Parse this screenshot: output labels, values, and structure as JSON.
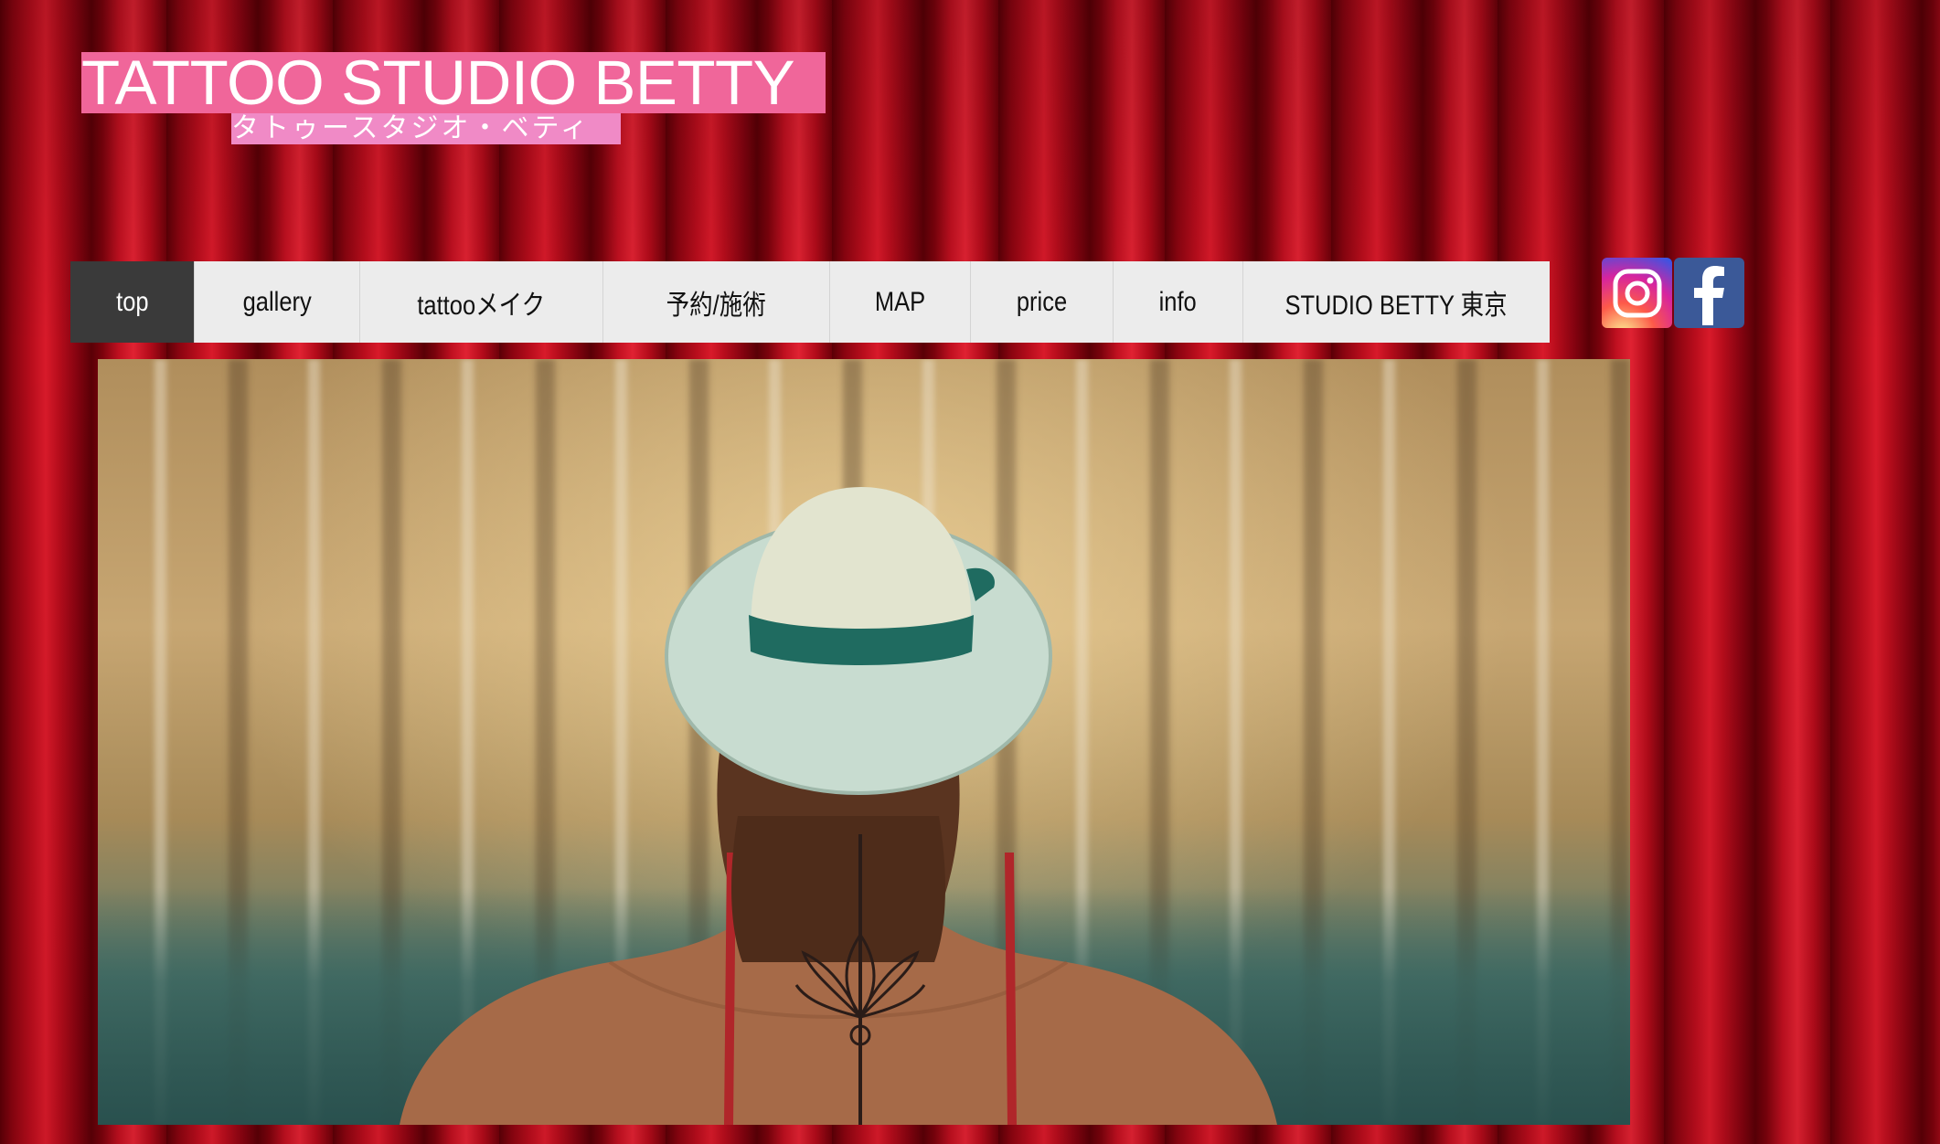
{
  "site": {
    "title": "TATTOO STUDIO BETTY",
    "subtitle": "タトゥースタジオ・ベティ"
  },
  "nav": {
    "items": [
      {
        "label": "top",
        "active": true
      },
      {
        "label": "gallery",
        "active": false
      },
      {
        "label": "tattooメイク",
        "active": false
      },
      {
        "label": "予約/施術",
        "active": false
      },
      {
        "label": "MAP",
        "active": false
      },
      {
        "label": "price",
        "active": false
      },
      {
        "label": "info",
        "active": false
      },
      {
        "label": "STUDIO BETTY 東京",
        "active": false
      }
    ]
  },
  "social": {
    "icons": [
      "instagram-icon",
      "facebook-icon"
    ]
  },
  "hero": {
    "description_icon": "photo"
  },
  "colors": {
    "logo_bg": "#f0669a",
    "subtitle_bg": "#f08ac6",
    "nav_bg": "#ececec",
    "nav_active_bg": "#3a3a3a",
    "curtain": "#b80d1c",
    "facebook": "#3b5998"
  }
}
